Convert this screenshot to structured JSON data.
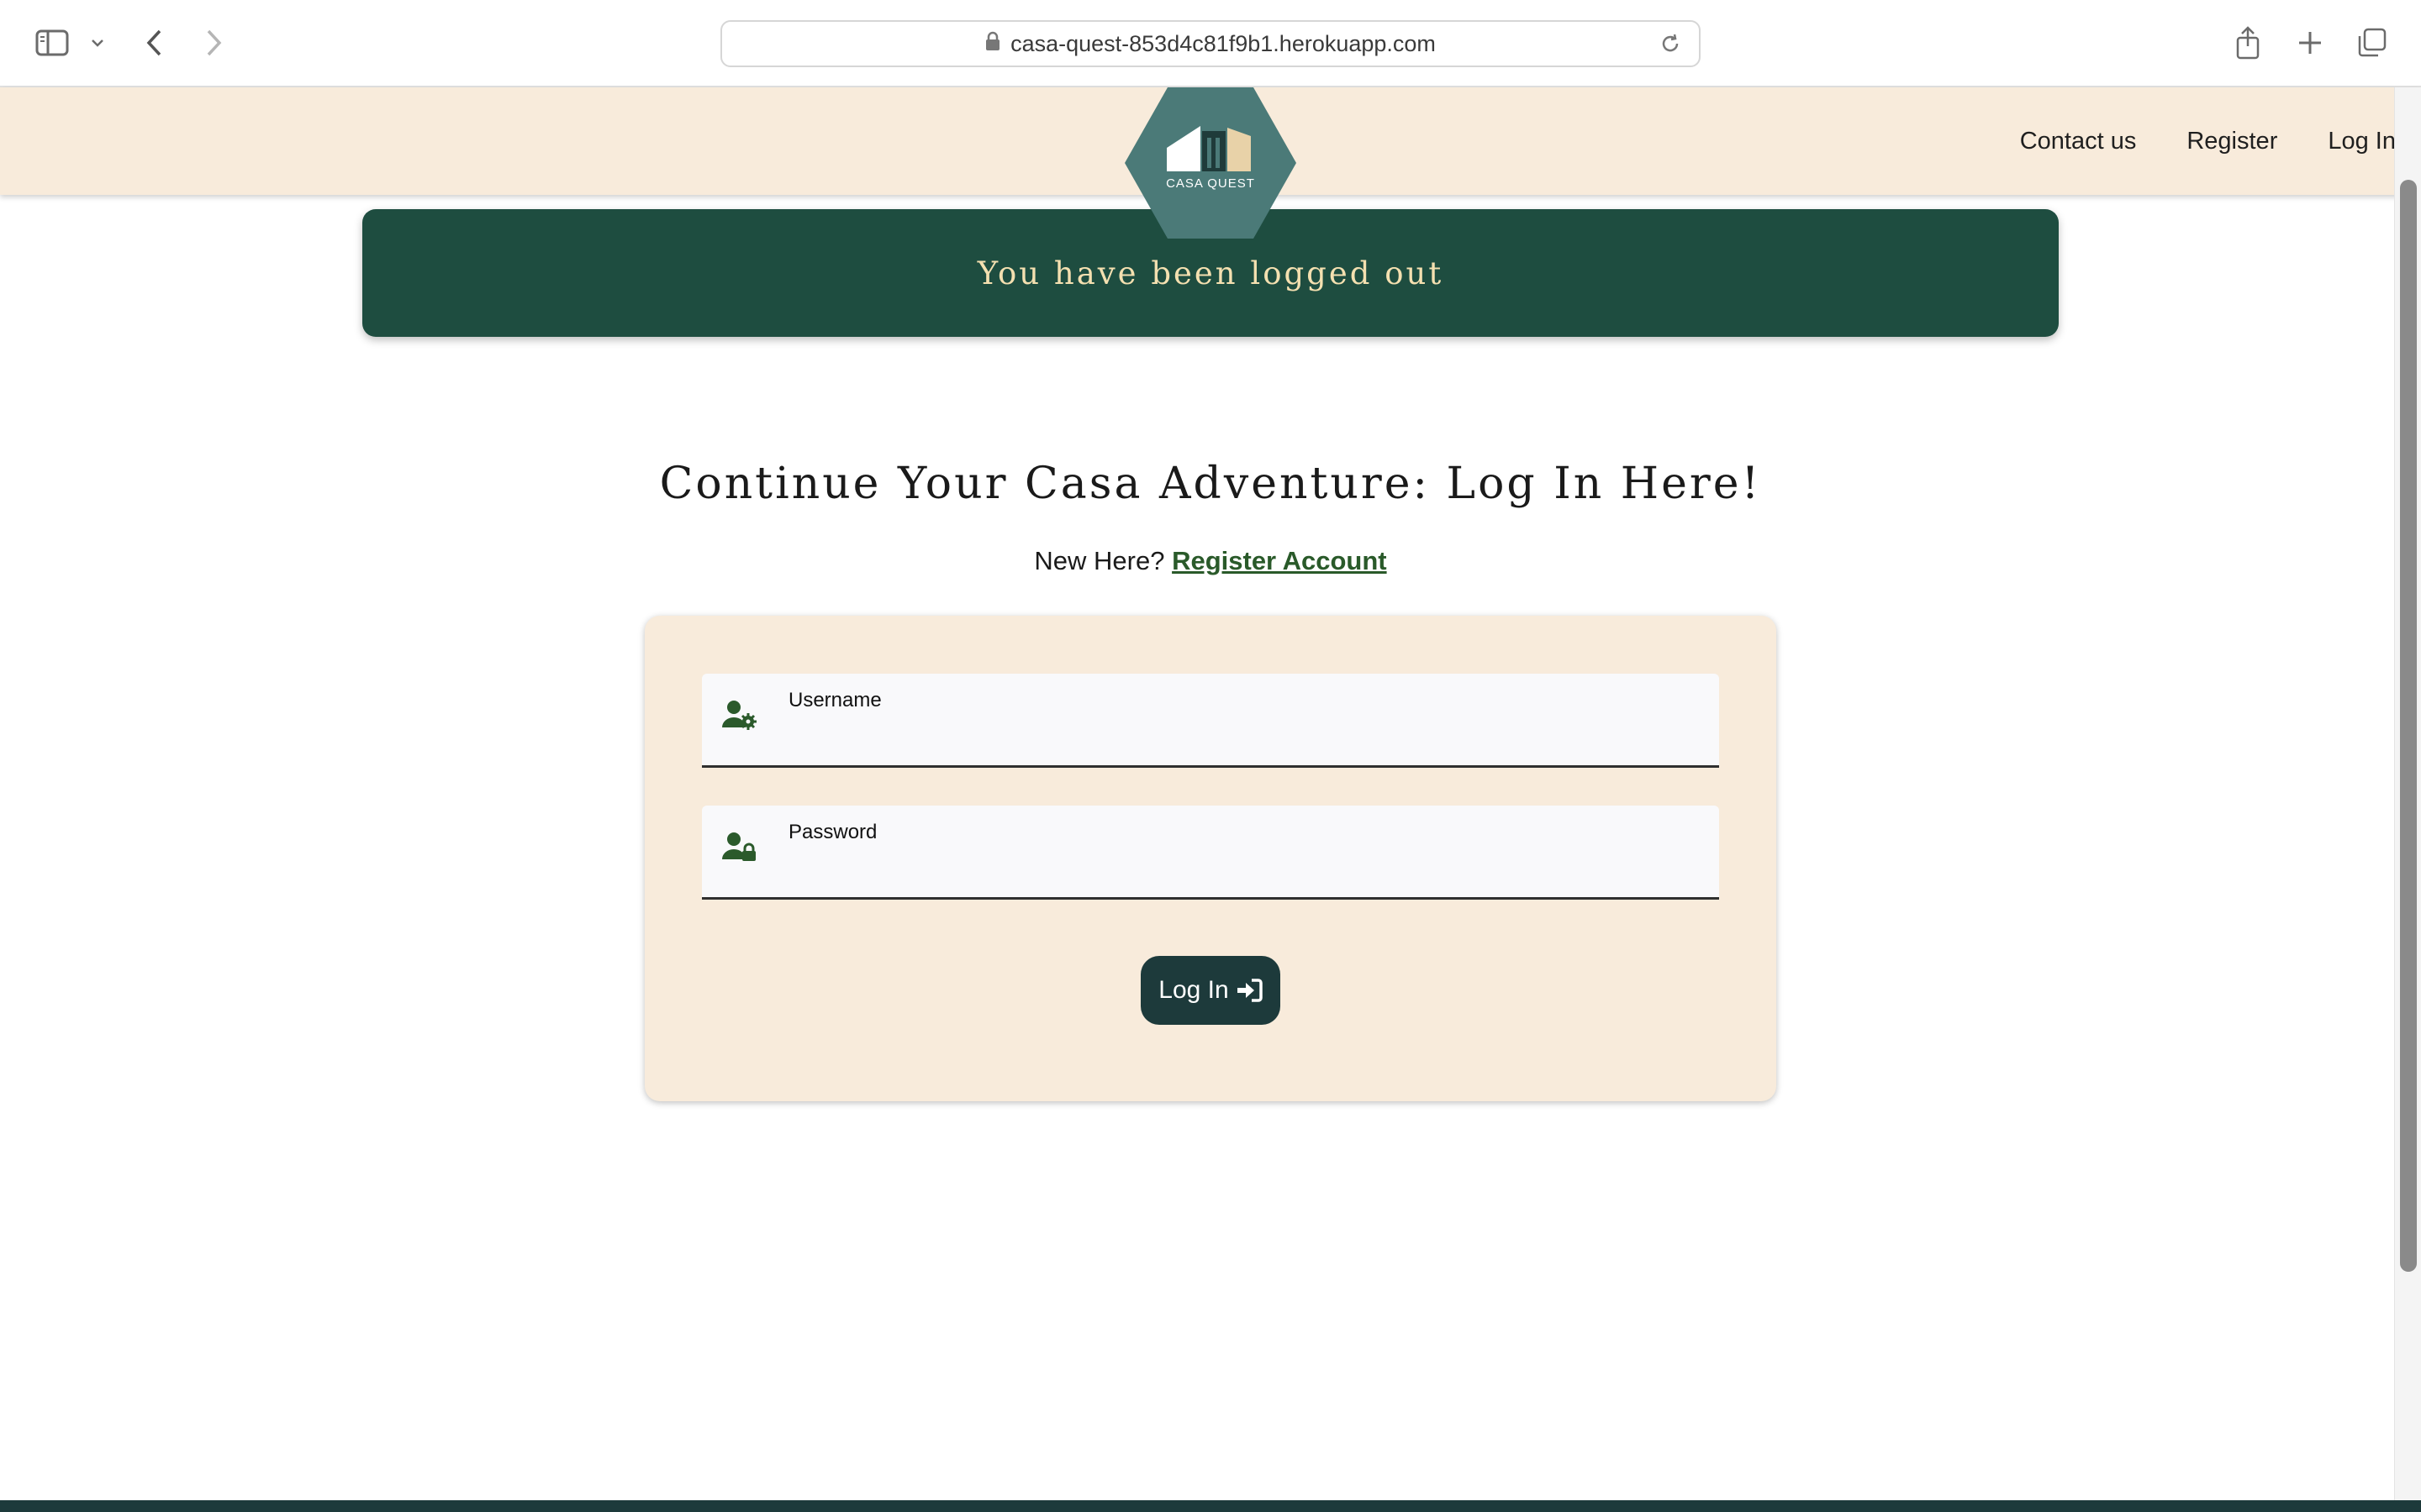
{
  "browser": {
    "url": "casa-quest-853d4c81f9b1.herokuapp.com"
  },
  "header": {
    "logo_text": "CASA QUEST",
    "nav": [
      {
        "label": "Contact us"
      },
      {
        "label": "Register"
      },
      {
        "label": "Log In"
      }
    ]
  },
  "alert": {
    "message": "You have been logged out"
  },
  "main": {
    "heading": "Continue Your Casa Adventure: Log In Here!",
    "prompt": "New Here?",
    "register_link": "Register Account"
  },
  "form": {
    "username_label": "Username",
    "password_label": "Password",
    "submit_label": "Log In"
  },
  "colors": {
    "header_bg": "#f8ebdb",
    "alert_bg": "#1e4d40",
    "alert_text": "#f4e0b0",
    "button_bg": "#1d3a3b",
    "link": "#2a5a2a",
    "logo_hex": "#4b7a78"
  }
}
